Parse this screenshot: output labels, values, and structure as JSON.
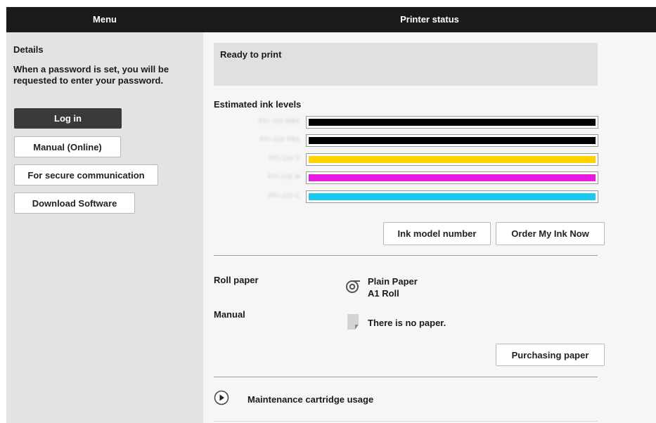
{
  "header": {
    "menu_title": "Menu",
    "status_title": "Printer status"
  },
  "sidebar": {
    "details_label": "Details",
    "details_text": "When a password is set, you will be requested to enter your password.",
    "buttons": {
      "login": "Log in",
      "manual_online": "Manual (Online)",
      "secure_communication": "For secure communication",
      "download_software": "Download Software"
    }
  },
  "status": {
    "message": "Ready to print"
  },
  "ink": {
    "heading": "Estimated ink levels",
    "tanks": [
      {
        "name": "PFI-110 MBK",
        "color": "#000000",
        "level_pct": 100
      },
      {
        "name": "PFI-110 PBK",
        "color": "#000000",
        "level_pct": 100
      },
      {
        "name": "PFI-110 Y",
        "color": "#ffd200",
        "level_pct": 100
      },
      {
        "name": "PFI-110 M",
        "color": "#e619e0",
        "level_pct": 100
      },
      {
        "name": "PFI-110 C",
        "color": "#1bc8ef",
        "level_pct": 100
      }
    ],
    "buttons": {
      "ink_model_number": "Ink model number",
      "order_my_ink_now": "Order My Ink Now"
    }
  },
  "paper": {
    "roll": {
      "label": "Roll paper",
      "type": "Plain Paper",
      "size": "A1 Roll",
      "icon": "roll-paper-icon"
    },
    "manual": {
      "label": "Manual",
      "status": "There is no paper.",
      "icon": "sheet-paper-icon"
    },
    "purchase_button": "Purchasing paper"
  },
  "maintenance": {
    "label": "Maintenance cartridge usage",
    "icon": "expand-play-icon"
  }
}
